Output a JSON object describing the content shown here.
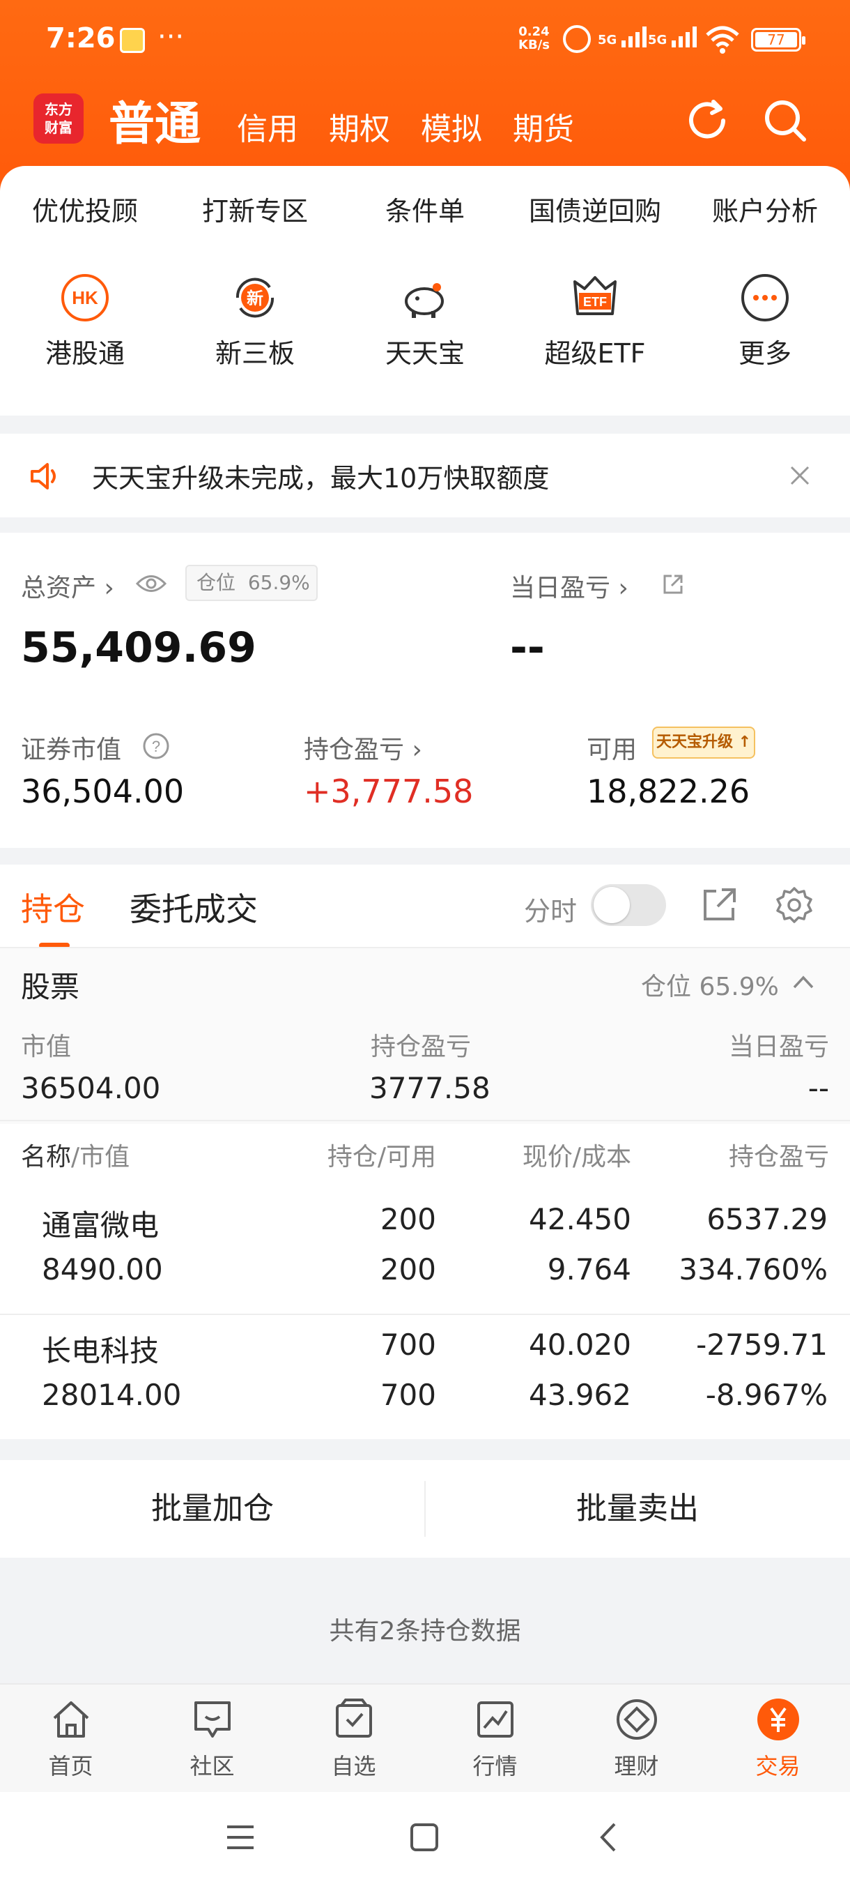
{
  "status_bar": {
    "time": "7:26",
    "net_speed_top": "0.24",
    "net_speed_bottom": "KB/s",
    "sig1": "5G",
    "sig2": "5G",
    "battery": "77"
  },
  "header": {
    "logo_line1": "东方",
    "logo_line2": "财富",
    "tabs": [
      "普通",
      "信用",
      "期权",
      "模拟",
      "期货"
    ]
  },
  "grid": {
    "row1": [
      "优优投顾",
      "打新专区",
      "条件单",
      "国债逆回购",
      "账户分析"
    ],
    "row2": [
      "港股通",
      "新三板",
      "天天宝",
      "超级ETF",
      "更多"
    ],
    "hk_icon_text": "HK",
    "xin_icon_text": "新",
    "etf_icon_text": "ETF"
  },
  "notice": {
    "text": "天天宝升级未完成，最大10万快取额度"
  },
  "assets": {
    "total_label": "总资产",
    "position_badge_label": "仓位",
    "position_badge_value": "65.9%",
    "total_value": "55,409.69",
    "daily_pl_label": "当日盈亏",
    "daily_pl_value": "--",
    "market_value_label": "证券市值",
    "market_value": "36,504.00",
    "hold_pl_label": "持仓盈亏",
    "hold_pl_value": "+3,777.58",
    "available_label": "可用",
    "available_badge": "天天宝升级",
    "available_value": "18,822.26"
  },
  "holdings": {
    "tab_hold": "持仓",
    "tab_orders": "委托成交",
    "time_label": "分时",
    "section_title": "股票",
    "section_position": "仓位 65.9%",
    "summary_labels": [
      "市值",
      "持仓盈亏",
      "当日盈亏"
    ],
    "summary_values": [
      "36504.00",
      "3777.58",
      "--"
    ],
    "col_name": "名称",
    "col_name_sub": "/市值",
    "col_qty": "持仓/可用",
    "col_price": "现价/成本",
    "col_pl": "持仓盈亏",
    "rows": [
      {
        "name": "通富微电",
        "mv": "8490.00",
        "qty": "200",
        "avail": "200",
        "price": "42.450",
        "cost": "9.764",
        "pl": "6537.29",
        "pl_pct": "334.760%",
        "sign": "up"
      },
      {
        "name": "长电科技",
        "mv": "28014.00",
        "qty": "700",
        "avail": "700",
        "price": "40.020",
        "cost": "43.962",
        "pl": "-2759.71",
        "pl_pct": "-8.967%",
        "sign": "down"
      }
    ]
  },
  "batch": {
    "add": "批量加仓",
    "sell": "批量卖出",
    "count_text": "共有2条持仓数据"
  },
  "bottom_nav": [
    "首页",
    "社区",
    "自选",
    "行情",
    "理财",
    "交易"
  ],
  "colors": {
    "brand_orange": "#ff5a0a",
    "up_red": "#e02e24",
    "down_green": "#15a340"
  }
}
